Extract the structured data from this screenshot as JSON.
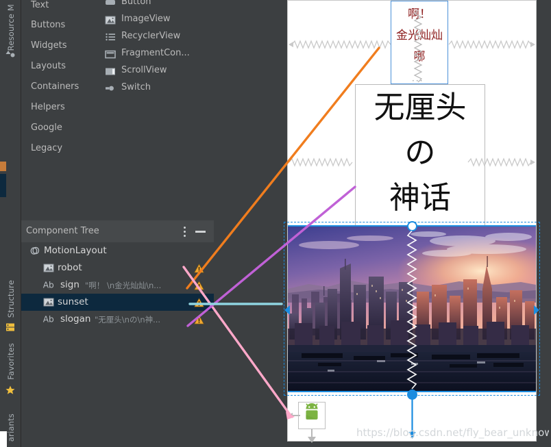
{
  "left_rail": {
    "tabs": [
      {
        "label": "Resource M",
        "icon": "palette-icon",
        "selected": false
      },
      {
        "label": "Structure",
        "icon": "structure-icon",
        "selected": false
      },
      {
        "label": "Favorites",
        "icon": "star-icon",
        "selected": false
      },
      {
        "label": "ariants",
        "icon": "variants-icon",
        "selected": false
      }
    ]
  },
  "palette": {
    "categories": [
      {
        "label": "Text"
      },
      {
        "label": "Buttons"
      },
      {
        "label": "Widgets"
      },
      {
        "label": "Layouts"
      },
      {
        "label": "Containers"
      },
      {
        "label": "Helpers"
      },
      {
        "label": "Google"
      },
      {
        "label": "Legacy"
      }
    ],
    "items": [
      {
        "label": "Button",
        "icon": "button-icon"
      },
      {
        "label": "ImageView",
        "icon": "image-icon"
      },
      {
        "label": "RecyclerView",
        "icon": "list-icon"
      },
      {
        "label": "FragmentCon...",
        "icon": "fragment-icon"
      },
      {
        "label": "ScrollView",
        "icon": "scrollview-icon"
      },
      {
        "label": "Switch",
        "icon": "switch-icon"
      }
    ]
  },
  "component_tree": {
    "title": "Component Tree",
    "menu_icon": "more-vertical-icon",
    "collapse_icon": "minimize-icon",
    "rows": [
      {
        "label": "MotionLayout",
        "value": "",
        "icon": "motionlayout-icon",
        "indent": 0,
        "warning": false,
        "selected": false
      },
      {
        "label": "robot",
        "value": "",
        "icon": "image-icon",
        "indent": 1,
        "warning": true,
        "selected": false
      },
      {
        "label": "sign",
        "value": "\"啊！ \\n金光灿灿\\n...",
        "icon": "text-icon",
        "indent": 1,
        "warning": true,
        "selected": false
      },
      {
        "label": "sunset",
        "value": "",
        "icon": "image-icon",
        "indent": 1,
        "warning": true,
        "selected": true
      },
      {
        "label": "slogan",
        "value": "\"无厘头\\nの\\n神...",
        "icon": "text-icon",
        "indent": 1,
        "warning": true,
        "selected": false
      }
    ]
  },
  "canvas": {
    "sign_widget": {
      "name": "sign",
      "lines": [
        "啊！",
        "金光灿灿",
        "哪"
      ],
      "text_color": "#8b1a1a",
      "border_color": "#4a90d9"
    },
    "slogan_widget": {
      "name": "slogan",
      "lines": [
        "无厘头",
        "の",
        "神话"
      ],
      "text_color": "#111111"
    },
    "sunset_widget": {
      "name": "sunset",
      "alt": "San Francisco skyline at sunset",
      "selected": true,
      "selection_color": "#1a8ce0"
    },
    "robot_widget": {
      "name": "robot",
      "icon": "android-robot-icon",
      "color": "#7cb342"
    },
    "watermark": "https://blog.csdn.net/fly_bear_unknown"
  },
  "annotations": {
    "arrows": [
      {
        "name": "sign-arrow",
        "color": "#f07d1e",
        "target": "sign"
      },
      {
        "name": "robot-arrow",
        "color": "#ffa8c9",
        "target": "robot"
      },
      {
        "name": "slogan-arrow",
        "color": "#c061d6",
        "target": "slogan"
      },
      {
        "name": "sunset-line",
        "color": "#8fd4e0",
        "target": "sunset"
      }
    ]
  },
  "colors": {
    "panel_bg": "#3c3f41",
    "header_bg": "#46494b",
    "selection_row": "#0d293e",
    "text": "#bbbbbb",
    "accent": "#1a8ce0",
    "warning": "#f0a732"
  }
}
